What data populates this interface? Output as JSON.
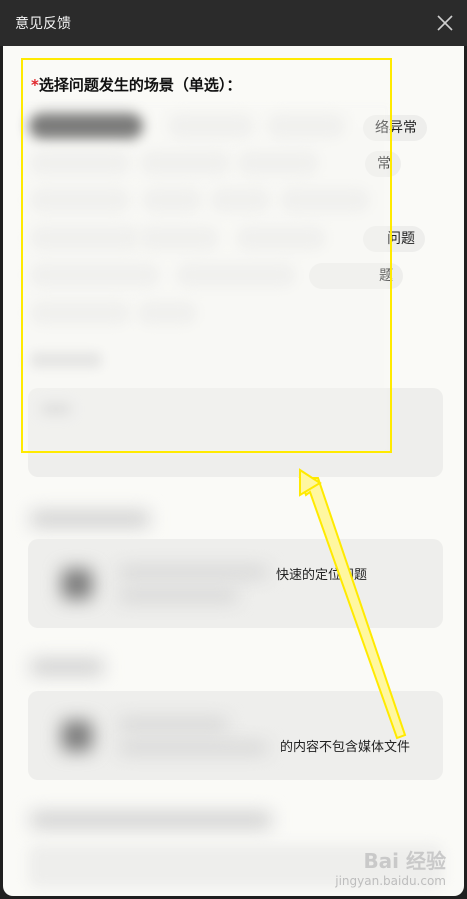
{
  "window": {
    "title": "意见反馈"
  },
  "form": {
    "required_mark": "*",
    "scene_heading": "选择问题发生的场景（单选）：",
    "visible_chip_fragments": [
      "络异常",
      "常",
      "问题",
      "题"
    ]
  },
  "partial_texts": {
    "upload1_hint": "快速的定位问题",
    "upload2_hint": "的内容不包含媒体文件"
  },
  "watermark": {
    "main": "Bai 经验",
    "sub": "jingyan.baidu.com"
  },
  "colors": {
    "highlight": "#ffea00",
    "required": "#e0262b",
    "chip_bg": "#eeeeec",
    "selected_chip_bg": "#3a3a3a"
  },
  "icons": {
    "close": "close-icon",
    "upload": "upload-icon"
  }
}
